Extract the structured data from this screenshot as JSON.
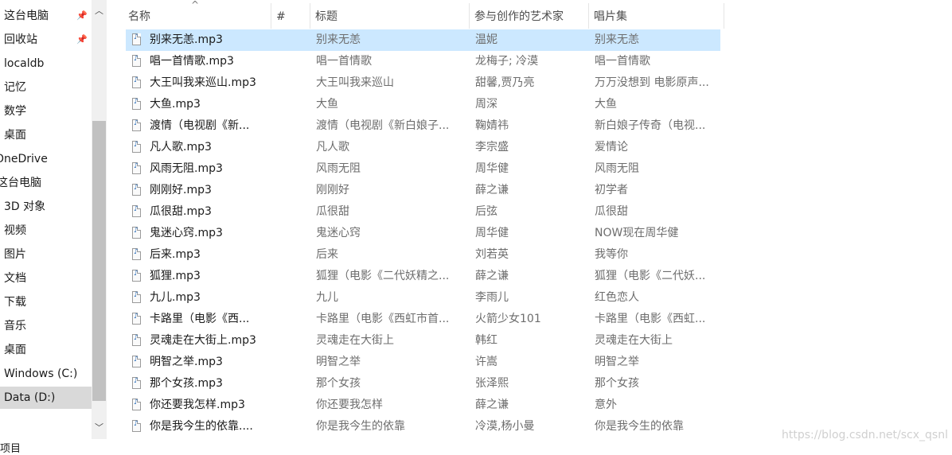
{
  "nav": {
    "items": [
      {
        "label": "这台电脑",
        "pinned": true,
        "indent": 5
      },
      {
        "label": "回收站",
        "pinned": true,
        "indent": 5
      },
      {
        "label": "localdb",
        "pinned": false,
        "indent": 5
      },
      {
        "label": "记忆",
        "pinned": false,
        "indent": 5
      },
      {
        "label": "数学",
        "pinned": false,
        "indent": 5
      },
      {
        "label": "桌面",
        "pinned": false,
        "indent": 5
      },
      {
        "label": "OneDrive",
        "pinned": false,
        "indent": -6
      },
      {
        "label": "这台电脑",
        "pinned": false,
        "indent": -4
      },
      {
        "label": "3D 对象",
        "pinned": false,
        "indent": 5
      },
      {
        "label": "视频",
        "pinned": false,
        "indent": 5
      },
      {
        "label": "图片",
        "pinned": false,
        "indent": 5
      },
      {
        "label": "文档",
        "pinned": false,
        "indent": 5
      },
      {
        "label": "下载",
        "pinned": false,
        "indent": 5
      },
      {
        "label": "音乐",
        "pinned": false,
        "indent": 5
      },
      {
        "label": "桌面",
        "pinned": false,
        "indent": 5
      },
      {
        "label": "Windows (C:)",
        "pinned": false,
        "indent": 5
      },
      {
        "label": "Data (D:)",
        "pinned": false,
        "indent": 5,
        "selected": true
      }
    ],
    "footer_text": "项目"
  },
  "columns": {
    "name": "名称",
    "number": "#",
    "title": "标题",
    "artist": "参与创作的艺术家",
    "album": "唱片集"
  },
  "files": [
    {
      "name": "别来无恙.mp3",
      "title": "别来无恙",
      "artist": "温妮",
      "album": "别来无恙",
      "selected": true
    },
    {
      "name": "唱一首情歌.mp3",
      "title": "唱一首情歌",
      "artist": "龙梅子; 冷漠",
      "album": "唱一首情歌"
    },
    {
      "name": "大王叫我来巡山.mp3",
      "title": "大王叫我来巡山",
      "artist": "甜馨,贾乃亮",
      "album": "万万没想到 电影原声..."
    },
    {
      "name": "大鱼.mp3",
      "title": "大鱼",
      "artist": "周深",
      "album": "大鱼"
    },
    {
      "name": "渡情（电视剧《新...",
      "title": "渡情（电视剧《新白娘子...",
      "artist": "鞠婧祎",
      "album": "新白娘子传奇（电视..."
    },
    {
      "name": "凡人歌.mp3",
      "title": "凡人歌",
      "artist": "李宗盛",
      "album": "爱情论"
    },
    {
      "name": "风雨无阻.mp3",
      "title": "风雨无阻",
      "artist": "周华健",
      "album": "风雨无阻"
    },
    {
      "name": "刚刚好.mp3",
      "title": "刚刚好",
      "artist": "薛之谦",
      "album": "初学者"
    },
    {
      "name": "瓜很甜.mp3",
      "title": "瓜很甜",
      "artist": "后弦",
      "album": "瓜很甜"
    },
    {
      "name": "鬼迷心窍.mp3",
      "title": "鬼迷心窍",
      "artist": "周华健",
      "album": "NOW现在周华健"
    },
    {
      "name": "后来.mp3",
      "title": "后来",
      "artist": "刘若英",
      "album": "我等你"
    },
    {
      "name": "狐狸.mp3",
      "title": "狐狸（电影《二代妖精之...",
      "artist": "薛之谦",
      "album": "狐狸（电影《二代妖..."
    },
    {
      "name": "九儿.mp3",
      "title": "九儿",
      "artist": "李雨儿",
      "album": "红色恋人"
    },
    {
      "name": "卡路里（电影《西...",
      "title": "卡路里（电影《西虹市首...",
      "artist": "火箭少女101",
      "album": "卡路里（电影《西虹..."
    },
    {
      "name": "灵魂走在大街上.mp3",
      "title": "灵魂走在大街上",
      "artist": "韩红",
      "album": "灵魂走在大街上"
    },
    {
      "name": "明智之举.mp3",
      "title": "明智之举",
      "artist": "许嵩",
      "album": "明智之举"
    },
    {
      "name": "那个女孩.mp3",
      "title": "那个女孩",
      "artist": "张泽熙",
      "album": "那个女孩"
    },
    {
      "name": "你还要我怎样.mp3",
      "title": "你还要我怎样",
      "artist": "薛之谦",
      "album": "意外"
    },
    {
      "name": "你是我今生的依靠....",
      "title": "你是我今生的依靠",
      "artist": "冷漠,杨小曼",
      "album": "你是我今生的依靠"
    }
  ],
  "watermark": "https://blog.csdn.net/scx_qsnl",
  "icons": {
    "pin": "pin-icon",
    "file": "mp3-file-icon",
    "sort": "sort-ascending-icon",
    "scroll_up": "chevron-up-icon",
    "scroll_down": "chevron-down-icon"
  }
}
